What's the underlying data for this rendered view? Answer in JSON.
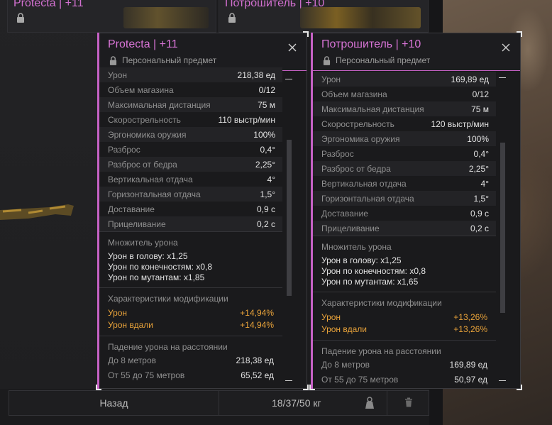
{
  "background_cards": [
    {
      "title": "Protecta | +11"
    },
    {
      "title": "Потрошитель | +10"
    }
  ],
  "panels": [
    {
      "title": "Protecta | +11",
      "subtitle": "Персональный предмет",
      "stats": [
        {
          "label": "Урон",
          "value": "218,38 ед"
        },
        {
          "label": "Объем магазина",
          "value": "0/12"
        },
        {
          "label": "Максимальная дистанция",
          "value": "75 м"
        },
        {
          "label": "Скорострельность",
          "value": "110 выстр/мин"
        },
        {
          "label": "Эргономика оружия",
          "value": "100%"
        },
        {
          "label": "Разброс",
          "value": "0,4°"
        },
        {
          "label": "Разброс от бедра",
          "value": "2,25°"
        },
        {
          "label": "Вертикальная отдача",
          "value": "4°"
        },
        {
          "label": "Горизонтальная отдача",
          "value": "1,5°"
        },
        {
          "label": "Доставание",
          "value": "0,9 с"
        },
        {
          "label": "Прицеливание",
          "value": "0,2 с"
        }
      ],
      "multiplier_header": "Множитель урона",
      "multipliers": [
        "Урон в голову: x1,25",
        "Урон по конечностям: x0,8",
        "Урон по мутантам: x1,85"
      ],
      "mods_header": "Характеристики модификации",
      "mods": [
        {
          "label": "Урон",
          "value": "+14,94%"
        },
        {
          "label": "Урон вдали",
          "value": "+14,94%"
        }
      ],
      "falloff_header": "Падение урона на расстоянии",
      "falloff": [
        {
          "label": "До 8 метров",
          "value": "218,38 ед"
        },
        {
          "label": "От 55 до 75 метров",
          "value": "65,52 ед"
        }
      ]
    },
    {
      "title": "Потрошитель | +10",
      "subtitle": "Персональный предмет",
      "stats": [
        {
          "label": "Урон",
          "value": "169,89 ед"
        },
        {
          "label": "Объем магазина",
          "value": "0/12"
        },
        {
          "label": "Максимальная дистанция",
          "value": "75 м"
        },
        {
          "label": "Скорострельность",
          "value": "120 выстр/мин"
        },
        {
          "label": "Эргономика оружия",
          "value": "100%"
        },
        {
          "label": "Разброс",
          "value": "0,4°"
        },
        {
          "label": "Разброс от бедра",
          "value": "2,25°"
        },
        {
          "label": "Вертикальная отдача",
          "value": "4°"
        },
        {
          "label": "Горизонтальная отдача",
          "value": "1,5°"
        },
        {
          "label": "Доставание",
          "value": "0,9 с"
        },
        {
          "label": "Прицеливание",
          "value": "0,2 с"
        }
      ],
      "multiplier_header": "Множитель урона",
      "multipliers": [
        "Урон в голову: x1,25",
        "Урон по конечностям: x0,8",
        "Урон по мутантам: x1,65"
      ],
      "mods_header": "Характеристики модификации",
      "mods": [
        {
          "label": "Урон",
          "value": "+13,26%"
        },
        {
          "label": "Урон вдали",
          "value": "+13,26%"
        }
      ],
      "falloff_header": "Падение урона на расстоянии",
      "falloff": [
        {
          "label": "До 8 метров",
          "value": "169,89 ед"
        },
        {
          "label": "От 55 до 75 метров",
          "value": "50,97 ед"
        }
      ]
    }
  ],
  "bottom": {
    "back_label": "Назад",
    "weight": "18/37/50 кг"
  },
  "colors": {
    "accent": "#c561c4",
    "title": "#d874d6",
    "mod": "#e9a33a"
  }
}
